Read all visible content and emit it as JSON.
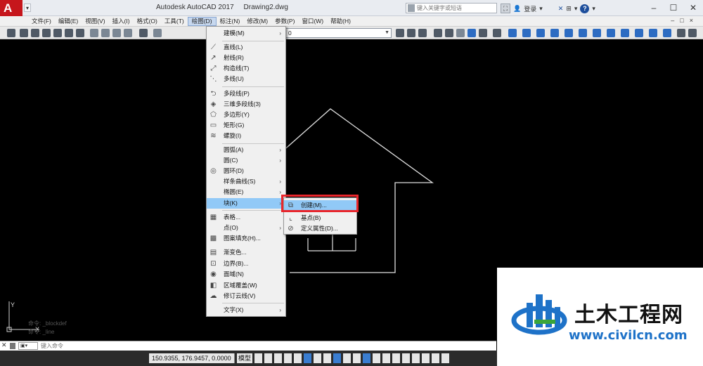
{
  "titlebar": {
    "logo": "A",
    "title": "Autodesk AutoCAD 2017     Drawing2.dwg",
    "search_placeholder": "键入关键字或短语",
    "login": "登录",
    "icons": [
      "binoculars-icon",
      "user-icon",
      "exchange-icon",
      "help-icon"
    ],
    "help": "?"
  },
  "menubar": {
    "items": [
      "文件(F)",
      "编辑(E)",
      "视图(V)",
      "插入(I)",
      "格式(O)",
      "工具(T)",
      "绘图(D)",
      "标注(N)",
      "修改(M)",
      "参数(P)",
      "窗口(W)",
      "帮助(H)"
    ],
    "active_index": 6
  },
  "toolbar": {
    "layer_value": "0"
  },
  "draw_menu": {
    "items": [
      {
        "label": "建模(M)",
        "icon": "",
        "sub": true
      },
      {
        "label": "直线(L)",
        "icon": "line-icon",
        "sub": false
      },
      {
        "label": "射线(R)",
        "icon": "ray-icon",
        "sub": false
      },
      {
        "label": "构造线(T)",
        "icon": "xline-icon",
        "sub": false
      },
      {
        "label": "多线(U)",
        "icon": "mline-icon",
        "sub": false
      },
      {
        "label": "多段线(P)",
        "icon": "polyline-icon",
        "sub": false
      },
      {
        "label": "三维多段线(3)",
        "icon": "3dpoly-icon",
        "sub": false
      },
      {
        "label": "多边形(Y)",
        "icon": "polygon-icon",
        "sub": false
      },
      {
        "label": "矩形(G)",
        "icon": "rectangle-icon",
        "sub": false
      },
      {
        "label": "螺旋(I)",
        "icon": "helix-icon",
        "sub": false
      },
      {
        "label": "圆弧(A)",
        "icon": "",
        "sub": true
      },
      {
        "label": "圆(C)",
        "icon": "",
        "sub": true
      },
      {
        "label": "圆环(D)",
        "icon": "donut-icon",
        "sub": false
      },
      {
        "label": "样条曲线(S)",
        "icon": "",
        "sub": true
      },
      {
        "label": "椭圆(E)",
        "icon": "",
        "sub": true
      },
      {
        "label": "块(K)",
        "icon": "",
        "sub": true
      },
      {
        "label": "表格...",
        "icon": "table-icon",
        "sub": false
      },
      {
        "label": "点(O)",
        "icon": "",
        "sub": true
      },
      {
        "label": "图案填充(H)...",
        "icon": "hatch-icon",
        "sub": false
      },
      {
        "label": "渐变色...",
        "icon": "gradient-icon",
        "sub": false
      },
      {
        "label": "边界(B)...",
        "icon": "boundary-icon",
        "sub": false
      },
      {
        "label": "面域(N)",
        "icon": "region-icon",
        "sub": false
      },
      {
        "label": "区域覆盖(W)",
        "icon": "wipeout-icon",
        "sub": false
      },
      {
        "label": "修订云线(V)",
        "icon": "revcloud-icon",
        "sub": false
      },
      {
        "label": "文字(X)",
        "icon": "",
        "sub": true
      }
    ],
    "highlighted_index": 15
  },
  "block_submenu": {
    "items": [
      {
        "label": "创建(M)...",
        "icon": "block-create-icon"
      },
      {
        "label": "基点(B)",
        "icon": "base-point-icon"
      },
      {
        "label": "定义属性(D)...",
        "icon": "define-attribute-icon"
      }
    ],
    "highlighted_index": 0
  },
  "commandline": {
    "placeholder": "键入命令",
    "history": [
      "命令: _blockdef",
      "命令: _line"
    ]
  },
  "statusbar": {
    "coords": "150.9355, 176.9457, 0.0000",
    "model": "模型"
  },
  "ucs": {
    "x": "X",
    "y": "Y"
  },
  "watermark": {
    "title": "土木工程网",
    "url": "www.civilcn.com"
  }
}
